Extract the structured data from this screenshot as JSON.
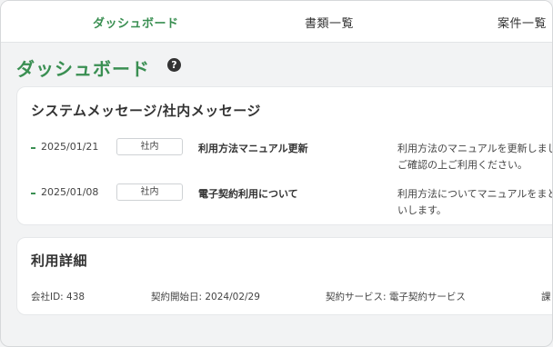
{
  "nav": {
    "tabs": [
      {
        "label": "ダッシュボード",
        "active": true
      },
      {
        "label": "書類一覧",
        "active": false
      },
      {
        "label": "案件一覧",
        "active": false
      }
    ]
  },
  "page": {
    "title": "ダッシュボード",
    "help_icon": "?"
  },
  "messages": {
    "title": "システムメッセージ/社内メッセージ",
    "items": [
      {
        "date": "2025/01/21",
        "badge": "社内",
        "title": "利用方法マニュアル更新",
        "body_line1": "利用方法のマニュアルを更新しまし",
        "body_line2": "ご確認の上ご利用ください。"
      },
      {
        "date": "2025/01/08",
        "badge": "社内",
        "title": "電子契約利用について",
        "body_line1": "利用方法についてマニュアルをまと",
        "body_line2": "いします。"
      }
    ]
  },
  "usage": {
    "title": "利用詳細",
    "company_id": "会社ID: 438",
    "contract_start": "契約開始日: 2024/02/29",
    "contract_service": "契約サービス: 電子契約サービス",
    "extra_partial": "課"
  },
  "colors": {
    "accent": "#3a8f52",
    "background": "#f2f3f4",
    "card": "#ffffff"
  }
}
